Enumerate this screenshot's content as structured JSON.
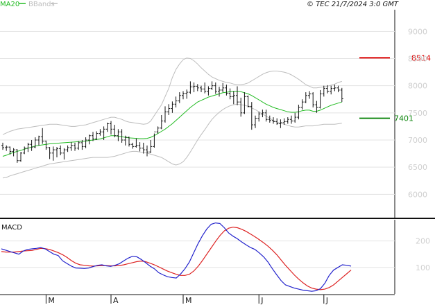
{
  "header": {
    "legend_ma20": "MA20",
    "legend_bbands": "BBands",
    "copyright": "© TEC 21/7/2024 3:0 GMT"
  },
  "colors": {
    "ma20": "#22bb22",
    "bbands": "#bdbdbd",
    "price": "#111111",
    "resistance": "#dd0000",
    "support": "#118811",
    "macd_line": "#2222cc",
    "signal_line": "#dd2222",
    "grid": "#e3e3e3"
  },
  "chart_data": [
    {
      "type": "line",
      "name": "price",
      "y_ticks": [
        6000,
        6500,
        7000,
        7500,
        8000,
        8500,
        9000
      ],
      "y_tick_labels": [
        "6000",
        "6500",
        "7000",
        "7500",
        "8000",
        "8500",
        "9000"
      ],
      "ylim": [
        5570,
        9400
      ],
      "x_tick_labels": [
        "M",
        "A",
        "M",
        "J",
        "J"
      ],
      "x_tick_index": [
        12,
        30,
        50,
        71,
        89
      ],
      "levels": [
        {
          "label": "8514",
          "value": 8514,
          "color": "#dd0000"
        },
        {
          "label": "7401",
          "value": 7401,
          "color": "#118811"
        }
      ],
      "ohlc": [
        [
          6900,
          6950,
          6820,
          6860
        ],
        [
          6860,
          6900,
          6800,
          6870
        ],
        [
          6870,
          6880,
          6730,
          6790
        ],
        [
          6790,
          6850,
          6700,
          6820
        ],
        [
          6820,
          6830,
          6580,
          6620
        ],
        [
          6620,
          6780,
          6600,
          6760
        ],
        [
          6760,
          6880,
          6740,
          6850
        ],
        [
          6850,
          6950,
          6780,
          6920
        ],
        [
          6920,
          7000,
          6800,
          6870
        ],
        [
          6870,
          7050,
          6850,
          7000
        ],
        [
          7000,
          7080,
          6900,
          7060
        ],
        [
          7060,
          7220,
          6930,
          6980
        ],
        [
          6980,
          6990,
          6820,
          6860
        ],
        [
          6860,
          6870,
          6650,
          6760
        ],
        [
          6760,
          6880,
          6620,
          6820
        ],
        [
          6820,
          6870,
          6680,
          6840
        ],
        [
          6840,
          6900,
          6720,
          6760
        ],
        [
          6760,
          6850,
          6640,
          6820
        ],
        [
          6820,
          6900,
          6780,
          6860
        ],
        [
          6860,
          6960,
          6800,
          6900
        ],
        [
          6900,
          6950,
          6800,
          6850
        ],
        [
          6850,
          6980,
          6820,
          6950
        ],
        [
          6950,
          7000,
          6820,
          6880
        ],
        [
          6880,
          7050,
          6850,
          7000
        ],
        [
          7000,
          7100,
          6920,
          7080
        ],
        [
          7080,
          7150,
          6980,
          7020
        ],
        [
          7020,
          7160,
          7000,
          7120
        ],
        [
          7120,
          7200,
          7080,
          7150
        ],
        [
          7150,
          7250,
          7000,
          7200
        ],
        [
          7200,
          7320,
          7150,
          7300
        ],
        [
          7300,
          7350,
          7100,
          7200
        ],
        [
          7200,
          7280,
          7050,
          7080
        ],
        [
          7080,
          7200,
          6980,
          7150
        ],
        [
          7150,
          7200,
          6950,
          7000
        ],
        [
          7000,
          7080,
          6900,
          7050
        ],
        [
          7050,
          7060,
          6880,
          6920
        ],
        [
          6920,
          6950,
          6840,
          6880
        ],
        [
          6880,
          7030,
          6860,
          6900
        ],
        [
          6900,
          6960,
          6790,
          6850
        ],
        [
          6850,
          6950,
          6750,
          6820
        ],
        [
          6820,
          6900,
          6700,
          6780
        ],
        [
          6780,
          7000,
          6760,
          6880
        ],
        [
          6880,
          7120,
          6860,
          7150
        ],
        [
          7150,
          7250,
          7120,
          7220
        ],
        [
          7220,
          7460,
          7200,
          7350
        ],
        [
          7350,
          7620,
          7320,
          7520
        ],
        [
          7520,
          7660,
          7460,
          7580
        ],
        [
          7580,
          7710,
          7500,
          7660
        ],
        [
          7660,
          7800,
          7600,
          7720
        ],
        [
          7720,
          7880,
          7680,
          7820
        ],
        [
          7820,
          7900,
          7750,
          7860
        ],
        [
          7860,
          7930,
          7760,
          7880
        ],
        [
          7880,
          8080,
          7850,
          7980
        ],
        [
          7980,
          8060,
          7880,
          7990
        ],
        [
          7990,
          8030,
          7900,
          7960
        ],
        [
          7960,
          8000,
          7880,
          7940
        ],
        [
          7940,
          8060,
          7860,
          7900
        ],
        [
          7900,
          7990,
          7820,
          7950
        ],
        [
          7950,
          8080,
          7920,
          8000
        ],
        [
          8000,
          8060,
          7850,
          7900
        ],
        [
          7900,
          7980,
          7800,
          7920
        ],
        [
          7920,
          8050,
          7880,
          7960
        ],
        [
          7960,
          8020,
          7820,
          7860
        ],
        [
          7860,
          7950,
          7750,
          7800
        ],
        [
          7800,
          7900,
          7660,
          7820
        ],
        [
          7820,
          7990,
          7640,
          7700
        ],
        [
          7700,
          7780,
          7430,
          7500
        ],
        [
          7500,
          7880,
          7480,
          7800
        ],
        [
          7800,
          7820,
          7600,
          7620
        ],
        [
          7620,
          7700,
          7190,
          7280
        ],
        [
          7280,
          7450,
          7220,
          7400
        ],
        [
          7400,
          7520,
          7340,
          7480
        ],
        [
          7480,
          7560,
          7420,
          7500
        ],
        [
          7500,
          7560,
          7340,
          7380
        ],
        [
          7380,
          7450,
          7320,
          7360
        ],
        [
          7360,
          7420,
          7300,
          7340
        ],
        [
          7340,
          7400,
          7280,
          7300
        ],
        [
          7300,
          7380,
          7220,
          7320
        ],
        [
          7320,
          7400,
          7280,
          7340
        ],
        [
          7340,
          7420,
          7300,
          7380
        ],
        [
          7380,
          7450,
          7300,
          7350
        ],
        [
          7350,
          7500,
          7320,
          7420
        ],
        [
          7420,
          7650,
          7380,
          7600
        ],
        [
          7600,
          7750,
          7560,
          7700
        ],
        [
          7700,
          7880,
          7680,
          7820
        ],
        [
          7820,
          7900,
          7760,
          7850
        ],
        [
          7850,
          7880,
          7600,
          7650
        ],
        [
          7650,
          7720,
          7500,
          7600
        ],
        [
          7600,
          7920,
          7580,
          7850
        ],
        [
          7850,
          8000,
          7800,
          7950
        ],
        [
          7950,
          8010,
          7860,
          7900
        ],
        [
          7900,
          8000,
          7840,
          7950
        ],
        [
          7950,
          8020,
          7900,
          7960
        ],
        [
          7960,
          8000,
          7880,
          7920
        ],
        [
          7920,
          7960,
          7700,
          7760
        ]
      ],
      "ma20": [
        6700,
        6720,
        6750,
        6770,
        6790,
        6810,
        6830,
        6850,
        6870,
        6890,
        6900,
        6910,
        6920,
        6930,
        6935,
        6940,
        6945,
        6950,
        6955,
        6960,
        6965,
        6970,
        6975,
        6980,
        6990,
        7000,
        7010,
        7020,
        7040,
        7060,
        7080,
        7080,
        7070,
        7060,
        7050,
        7040,
        7035,
        7030,
        7025,
        7025,
        7030,
        7050,
        7080,
        7120,
        7160,
        7200,
        7250,
        7300,
        7360,
        7420,
        7480,
        7540,
        7600,
        7650,
        7700,
        7730,
        7760,
        7790,
        7810,
        7830,
        7850,
        7870,
        7880,
        7890,
        7900,
        7900,
        7890,
        7870,
        7850,
        7820,
        7780,
        7740,
        7700,
        7660,
        7630,
        7600,
        7580,
        7560,
        7540,
        7520,
        7510,
        7510,
        7520,
        7540,
        7550,
        7550,
        7530,
        7530,
        7550,
        7580,
        7610,
        7640,
        7660,
        7680,
        7700
      ],
      "bb_upper": [
        7100,
        7130,
        7160,
        7180,
        7200,
        7210,
        7220,
        7230,
        7240,
        7250,
        7260,
        7270,
        7280,
        7290,
        7290,
        7290,
        7280,
        7270,
        7260,
        7250,
        7250,
        7260,
        7270,
        7280,
        7300,
        7320,
        7340,
        7360,
        7380,
        7400,
        7420,
        7420,
        7400,
        7380,
        7350,
        7330,
        7320,
        7310,
        7300,
        7290,
        7300,
        7350,
        7450,
        7550,
        7650,
        7800,
        7950,
        8150,
        8300,
        8400,
        8480,
        8510,
        8500,
        8460,
        8400,
        8330,
        8270,
        8210,
        8160,
        8130,
        8100,
        8080,
        8060,
        8050,
        8030,
        8020,
        8020,
        8030,
        8050,
        8090,
        8130,
        8170,
        8210,
        8240,
        8260,
        8270,
        8270,
        8260,
        8250,
        8230,
        8200,
        8160,
        8120,
        8070,
        8020,
        7990,
        7960,
        7960,
        7970,
        7980,
        7990,
        8010,
        8030,
        8060,
        8080
      ],
      "bb_lower": [
        6300,
        6310,
        6340,
        6360,
        6380,
        6400,
        6420,
        6440,
        6460,
        6480,
        6500,
        6520,
        6540,
        6560,
        6570,
        6580,
        6590,
        6600,
        6610,
        6620,
        6630,
        6640,
        6650,
        6660,
        6670,
        6680,
        6680,
        6680,
        6680,
        6680,
        6690,
        6700,
        6720,
        6740,
        6760,
        6780,
        6790,
        6790,
        6780,
        6770,
        6760,
        6740,
        6720,
        6700,
        6680,
        6640,
        6600,
        6560,
        6540,
        6560,
        6600,
        6680,
        6780,
        6890,
        7000,
        7100,
        7190,
        7290,
        7380,
        7450,
        7510,
        7560,
        7600,
        7630,
        7650,
        7660,
        7650,
        7640,
        7620,
        7590,
        7560,
        7520,
        7480,
        7440,
        7400,
        7360,
        7330,
        7310,
        7290,
        7270,
        7250,
        7240,
        7240,
        7250,
        7260,
        7260,
        7260,
        7270,
        7280,
        7290,
        7290,
        7290,
        7290,
        7300,
        7310
      ]
    },
    {
      "type": "line",
      "name": "MACD",
      "title": "MACD",
      "y_ticks": [
        100,
        200
      ],
      "y_tick_labels": [
        "100",
        "200"
      ],
      "ylim": [
        0,
        280
      ],
      "macd": [
        170,
        165,
        160,
        155,
        150,
        162,
        168,
        170,
        172,
        175,
        170,
        160,
        150,
        145,
        125,
        115,
        105,
        98,
        97,
        96,
        98,
        103,
        108,
        110,
        106,
        104,
        108,
        114,
        125,
        135,
        142,
        140,
        130,
        118,
        105,
        95,
        80,
        72,
        65,
        62,
        60,
        75,
        95,
        120,
        155,
        190,
        220,
        245,
        263,
        268,
        266,
        250,
        230,
        218,
        208,
        196,
        185,
        175,
        168,
        155,
        140,
        120,
        95,
        72,
        50,
        34,
        28,
        22,
        18,
        14,
        12,
        10,
        12,
        20,
        40,
        70,
        90,
        100,
        110,
        108,
        105
      ],
      "signal": [
        160,
        158,
        158,
        158,
        160,
        162,
        163,
        164,
        168,
        172,
        171,
        168,
        162,
        156,
        148,
        138,
        126,
        116,
        110,
        108,
        106,
        105,
        106,
        107,
        107,
        106,
        106,
        107,
        110,
        114,
        118,
        122,
        124,
        122,
        116,
        110,
        102,
        94,
        86,
        80,
        74,
        70,
        70,
        74,
        86,
        104,
        126,
        150,
        174,
        198,
        220,
        238,
        248,
        252,
        250,
        244,
        236,
        226,
        216,
        205,
        193,
        180,
        165,
        148,
        128,
        108,
        90,
        72,
        56,
        42,
        30,
        22,
        18,
        16,
        18,
        24,
        34,
        48,
        62,
        76,
        90
      ]
    }
  ]
}
